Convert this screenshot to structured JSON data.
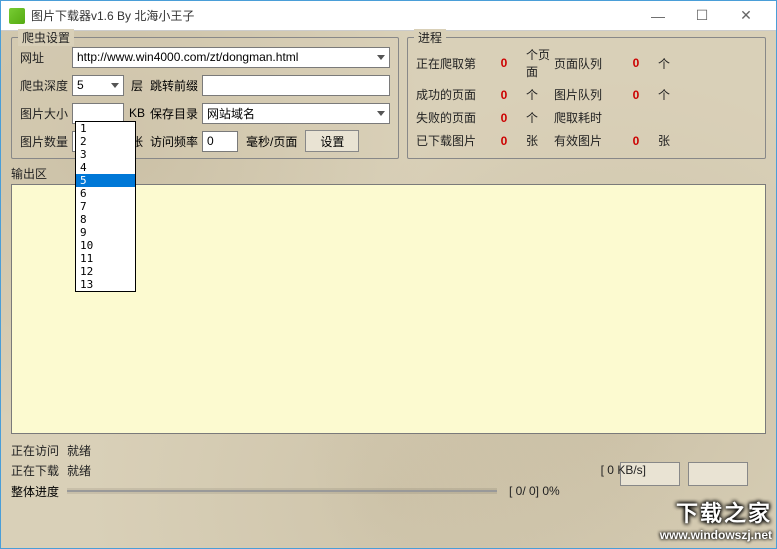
{
  "window": {
    "title": "图片下载器v1.6 By 北海小王子"
  },
  "crawler": {
    "group_title": "爬虫设置",
    "url_label": "网址",
    "url_value": "http://www.win4000.com/zt/dongman.html",
    "depth_label": "爬虫深度",
    "depth_value": "5",
    "depth_unit": "层",
    "depth_options": [
      "1",
      "2",
      "3",
      "4",
      "5",
      "6",
      "7",
      "8",
      "9",
      "10",
      "11",
      "12",
      "13"
    ],
    "prefix_label": "跳转前缀",
    "prefix_value": "",
    "size_label": "图片大小",
    "size_value": "",
    "size_unit": "KB",
    "savedir_label": "保存目录",
    "savedir_value": "网站域名",
    "count_label": "图片数量",
    "count_value": "",
    "count_unit": "张",
    "freq_label": "访问频率",
    "freq_value": "0",
    "freq_unit": "毫秒/页面",
    "set_btn": "设置"
  },
  "progress": {
    "group_title": "进程",
    "rows": [
      {
        "l1": "正在爬取第",
        "v1": "0",
        "u1": "个页面",
        "l2": "页面队列",
        "v2": "0",
        "u2": "个"
      },
      {
        "l1": "成功的页面",
        "v1": "0",
        "u1": "个",
        "l2": "图片队列",
        "v2": "0",
        "u2": "个"
      },
      {
        "l1": "失败的页面",
        "v1": "0",
        "u1": "个",
        "l2": "爬取耗时",
        "v2": "",
        "u2": ""
      },
      {
        "l1": "已下载图片",
        "v1": "0",
        "u1": "张",
        "l2": "有效图片",
        "v2": "0",
        "u2": "张"
      }
    ]
  },
  "output": {
    "label": "输出区"
  },
  "status": {
    "visit_label": "正在访问",
    "visit_value": "就绪",
    "download_label": "正在下载",
    "download_value": "就绪",
    "rate": "[    0 KB/s]",
    "overall_label": "整体进度",
    "overall_text": "[    0/    0]   0%"
  },
  "watermark": {
    "big": "下载之家",
    "url": "www.windowszj.net"
  }
}
